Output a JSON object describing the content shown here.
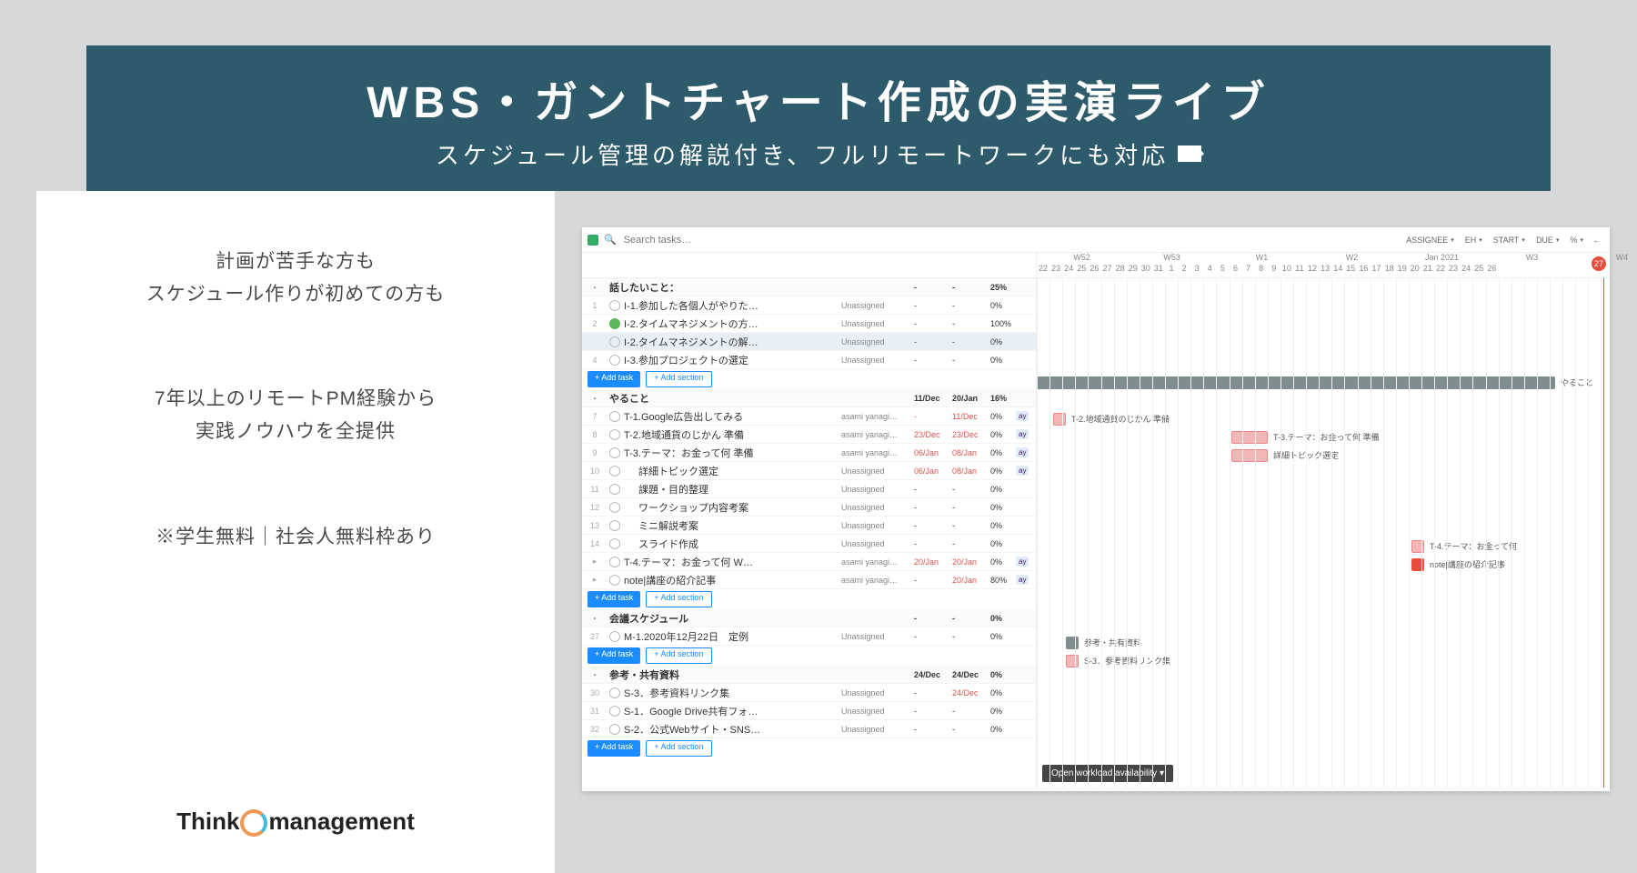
{
  "hero": {
    "title": "WBS・ガントチャート作成の実演ライブ",
    "subtitle": "スケジュール管理の解説付き、フルリモートワークにも対応"
  },
  "copy": {
    "p1a": "計画が苦手な方も",
    "p1b": "スケジュール作りが初めての方も",
    "p2a": "7年以上のリモートPM経験から",
    "p2b": "実践ノウハウを全提供",
    "p3": "※学生無料｜社会人無料枠あり"
  },
  "logo": {
    "left": "Think",
    "right": "management"
  },
  "app": {
    "search_placeholder": "Search tasks…",
    "columns": [
      "ASSIGNEE",
      "EH",
      "START",
      "DUE",
      "%"
    ],
    "add_task_label": "+  Add task",
    "add_section_label": "+  Add section",
    "workload_label": "Open workload availability  ▾",
    "timeline": {
      "weeks": [
        "W52",
        "W53",
        "W1",
        "W2",
        "Jan 2021",
        "W3",
        "W4"
      ],
      "days": [
        "22",
        "23",
        "24",
        "25",
        "26",
        "27",
        "28",
        "29",
        "30",
        "31",
        "1",
        "2",
        "3",
        "4",
        "5",
        "6",
        "7",
        "8",
        "9",
        "10",
        "11",
        "12",
        "13",
        "14",
        "15",
        "16",
        "17",
        "18",
        "19",
        "20",
        "21",
        "22",
        "23",
        "24",
        "25",
        "26"
      ],
      "today_label": "27"
    },
    "sections": [
      {
        "name": "話したいこと：",
        "pct": "25%",
        "rows": [
          {
            "i": "1",
            "n": "I-1.参加した各個人がやりた…",
            "as": "Unassigned",
            "s": "-",
            "d": "-",
            "p": "0%"
          },
          {
            "i": "2",
            "n": "I-2.タイムマネジメントの方…",
            "as": "Unassigned",
            "s": "-",
            "d": "-",
            "p": "100%",
            "done": true
          },
          {
            "i": "",
            "n": "I-2.タイムマネジメントの解…",
            "as": "Unassigned",
            "s": "-",
            "d": "-",
            "p": "0%",
            "hl": true
          },
          {
            "i": "4",
            "n": "I-3.参加プロジェクトの選定",
            "as": "Unassigned",
            "s": "-",
            "d": "-",
            "p": "0%"
          }
        ]
      },
      {
        "name": "やること",
        "s": "11/Dec",
        "d": "20/Jan",
        "pct": "16%",
        "rows": [
          {
            "i": "7",
            "n": "T-1.Google広告出してみる",
            "as": "asami yanagi…",
            "s": "-",
            "sred": true,
            "d": "11/Dec",
            "dred": true,
            "p": "0%",
            "av": "ay"
          },
          {
            "i": "8",
            "n": "T-2.地域通貨のじかん 準備",
            "as": "asami yanagi…",
            "s": "23/Dec",
            "sred": true,
            "d": "23/Dec",
            "dred": true,
            "p": "0%",
            "av": "ay"
          },
          {
            "i": "9",
            "n": "T-3.テーマ：お金って何 準備",
            "as": "asami yanagi…",
            "s": "06/Jan",
            "sred": true,
            "d": "08/Jan",
            "dred": true,
            "p": "0%",
            "av": "ay"
          },
          {
            "i": "10",
            "n": "詳細トピック選定",
            "as": "Unassigned",
            "s": "06/Jan",
            "sred": true,
            "d": "08/Jan",
            "dred": true,
            "p": "0%",
            "av": "ay",
            "ind": 1
          },
          {
            "i": "11",
            "n": "課題・目的整理",
            "as": "Unassigned",
            "s": "-",
            "d": "-",
            "p": "0%",
            "ind": 1
          },
          {
            "i": "12",
            "n": "ワークショップ内容考案",
            "as": "Unassigned",
            "s": "-",
            "d": "-",
            "p": "0%",
            "ind": 1
          },
          {
            "i": "13",
            "n": "ミニ解説考案",
            "as": "Unassigned",
            "s": "-",
            "d": "-",
            "p": "0%",
            "ind": 1
          },
          {
            "i": "14",
            "n": "スライド作成",
            "as": "Unassigned",
            "s": "-",
            "d": "-",
            "p": "0%",
            "ind": 1
          },
          {
            "i": "",
            "n": "T-4.テーマ：お金って何  W…",
            "as": "asami yanagi…",
            "s": "20/Jan",
            "sred": true,
            "d": "20/Jan",
            "dred": true,
            "p": "0%",
            "av": "ay",
            "exp": true
          },
          {
            "i": "",
            "n": "note|講座の紹介記事",
            "as": "asami yanagi…",
            "s": "-",
            "d": "20/Jan",
            "dred": true,
            "p": "80%",
            "av": "ay",
            "exp": true
          }
        ]
      },
      {
        "name": "会議スケジュール",
        "pct": "0%",
        "rows": [
          {
            "i": "27",
            "n": "M-1.2020年12月22日　定例",
            "as": "Unassigned",
            "s": "-",
            "d": "-",
            "p": "0%"
          }
        ]
      },
      {
        "name": "参考・共有資料",
        "s": "24/Dec",
        "d": "24/Dec",
        "pct": "0%",
        "rows": [
          {
            "i": "30",
            "n": "S-3．参考資料リンク集",
            "as": "Unassigned",
            "s": "-",
            "d": "24/Dec",
            "dred": true,
            "p": "0%"
          },
          {
            "i": "31",
            "n": "S-1．Google Drive共有フォ…",
            "as": "Unassigned",
            "s": "-",
            "d": "-",
            "p": "0%"
          },
          {
            "i": "32",
            "n": "S-2．公式Webサイト・SNS…",
            "as": "Unassigned",
            "s": "-",
            "d": "-",
            "p": "0%"
          }
        ]
      }
    ],
    "gantt_labels": {
      "yarukoto": "やること",
      "t2": "T-2.地域通貨のじかん 準備",
      "t3": "T-3.テーマ：お金って何 準備",
      "topic": "詳細トピック選定",
      "t4": "T-4.テーマ：お金って何",
      "note": "note|講座の紹介記事",
      "ref": "参考・共有資料",
      "s3": "S-3．参考資料リンク集"
    }
  }
}
